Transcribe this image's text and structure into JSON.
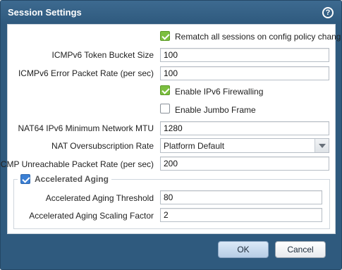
{
  "dialog": {
    "title": "Session Settings",
    "help_icon": "question-circle-icon"
  },
  "fields": {
    "rematch": {
      "label": "Rematch all sessions on config policy change",
      "checked": true
    },
    "icmpv6_bucket": {
      "label": "ICMPv6 Token Bucket Size",
      "value": "100"
    },
    "icmpv6_error_rate": {
      "label": "ICMPv6 Error Packet Rate (per sec)",
      "value": "100"
    },
    "ipv6_firewalling": {
      "label": "Enable IPv6 Firewalling",
      "checked": true
    },
    "jumbo_frame": {
      "label": "Enable Jumbo Frame",
      "checked": false
    },
    "nat64_mtu": {
      "label": "NAT64 IPv6 Minimum Network MTU",
      "value": "1280"
    },
    "nat_oversub": {
      "label": "NAT Oversubscription Rate",
      "value": "Platform Default"
    },
    "icmp_unreachable": {
      "label": "ICMP Unreachable Packet Rate (per sec)",
      "value": "200"
    }
  },
  "accelerated_aging": {
    "legend": "Accelerated Aging",
    "checked": true,
    "threshold": {
      "label": "Accelerated Aging Threshold",
      "value": "80"
    },
    "scaling": {
      "label": "Accelerated Aging Scaling Factor",
      "value": "2"
    }
  },
  "buttons": {
    "ok": "OK",
    "cancel": "Cancel"
  },
  "colors": {
    "title_bar": "#2f5a7e",
    "checkbox_green": "#7cbf3f",
    "checkbox_blue": "#3b7fd4"
  }
}
